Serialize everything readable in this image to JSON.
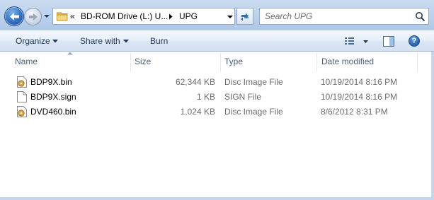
{
  "navigation": {
    "back_icon": "back-arrow-icon",
    "forward_icon": "forward-arrow-icon"
  },
  "address_bar": {
    "overflow_chevrons": "«",
    "drive_crumb": "BD-ROM Drive (L:) U...",
    "folder_crumb": "UPG"
  },
  "search": {
    "placeholder": "Search UPG"
  },
  "command_bar": {
    "organize_label": "Organize",
    "share_label": "Share with",
    "burn_label": "Burn"
  },
  "columns": {
    "name": "Name",
    "size": "Size",
    "type": "Type",
    "date": "Date modified"
  },
  "files": [
    {
      "name": "BDP9X.bin",
      "size": "62,344 KB",
      "type": "Disc Image File",
      "date": "10/19/2014 8:16 PM",
      "icon": "disc-image-file-icon"
    },
    {
      "name": "BDP9X.sign",
      "size": "1 KB",
      "type": "SIGN File",
      "date": "10/19/2014 8:16 PM",
      "icon": "generic-file-icon"
    },
    {
      "name": "DVD460.bin",
      "size": "1,024 KB",
      "type": "Disc Image File",
      "date": "8/6/2012 8:31 PM",
      "icon": "disc-image-file-icon"
    }
  ],
  "colors": {
    "address_bar_bg": "#bcd2ec",
    "command_bar_bg": "#dbe6f4",
    "link_text": "#1e395b",
    "secondary_text": "#6d6d6d"
  }
}
